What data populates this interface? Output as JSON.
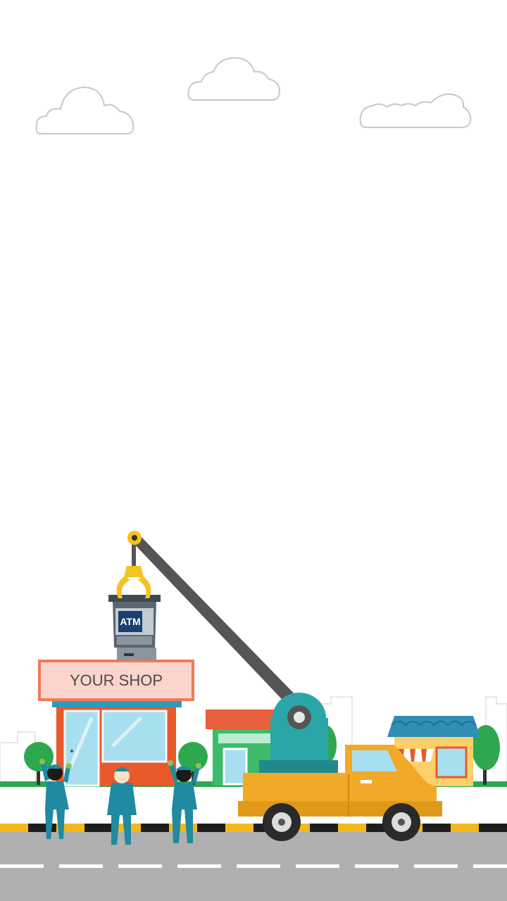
{
  "scene": {
    "shop_sign": "YOUR SHOP",
    "atm_label": "ATM"
  },
  "colors": {
    "sky": "#ffffff",
    "cloud_stroke": "#c8c8c8",
    "road": "#b0b0b0",
    "lane_mark": "#ffffff",
    "curb_yellow": "#f2b81c",
    "curb_black": "#1e1e1e",
    "shop_sign_fill": "#fbd5cc",
    "shop_sign_border": "#f07a5a",
    "shop_body": "#e85a2c",
    "window_glass": "#a8dff0",
    "crane_arm": "#555555",
    "crane_base": "#2aa6a8",
    "truck_body": "#f0aa28",
    "atm_body": "#5a6670",
    "claw": "#f4c321",
    "worker_uniform": "#1f8aa0",
    "tree_green": "#2da84f",
    "house_roof": "#2f8fb5",
    "house_wall": "#fbd06a"
  },
  "icons": [
    "cloud-icon",
    "crane-icon",
    "atm-icon",
    "truck-icon",
    "worker-icon",
    "tree-icon",
    "shop-icon",
    "house-icon"
  ]
}
